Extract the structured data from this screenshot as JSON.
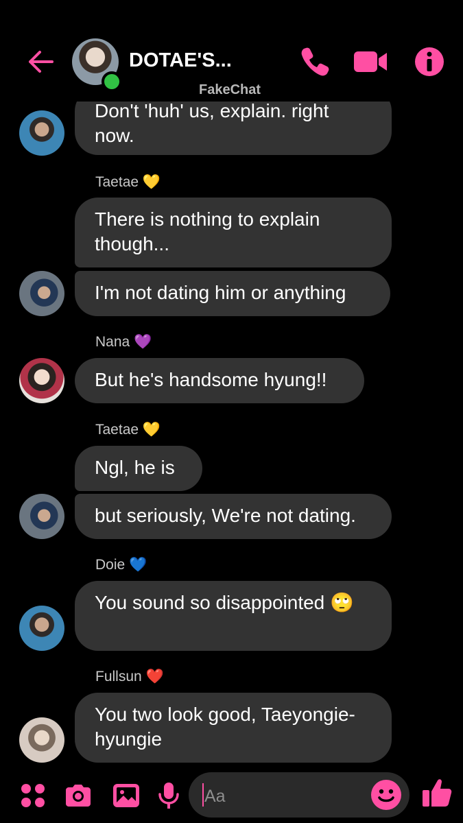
{
  "header": {
    "title": "DOTAE'S...",
    "subtitle": "FakeChat",
    "icons": [
      "back-arrow-icon",
      "phone-icon",
      "video-call-icon",
      "info-icon"
    ]
  },
  "messages": [
    {
      "sender": "Doie",
      "text": "Don't 'huh' us, explain. right now."
    },
    {
      "sender_label": "Taetae 💛",
      "text": "There is nothing to explain though..."
    },
    {
      "text": "I'm not dating him or anything"
    },
    {
      "sender_label": "Nana 💜",
      "text": "But he's handsome hyung!!"
    },
    {
      "sender_label": "Taetae 💛",
      "text": "Ngl, he is"
    },
    {
      "text": "but seriously, We're not dating."
    },
    {
      "sender_label": "Doie 💙",
      "text": "You sound so disappointed 🙄"
    },
    {
      "sender_label": "Fullsun ❤️",
      "text": "You two look good, Taeyongie-hyungie"
    }
  ],
  "composer": {
    "placeholder": "Aa",
    "icons": [
      "menu-dots-icon",
      "camera-icon",
      "gallery-icon",
      "microphone-icon",
      "emoji-icon",
      "thumbs-up-icon"
    ]
  },
  "colors": {
    "accent": "#ff4fa3",
    "bubble": "#333333",
    "background": "#000000"
  }
}
